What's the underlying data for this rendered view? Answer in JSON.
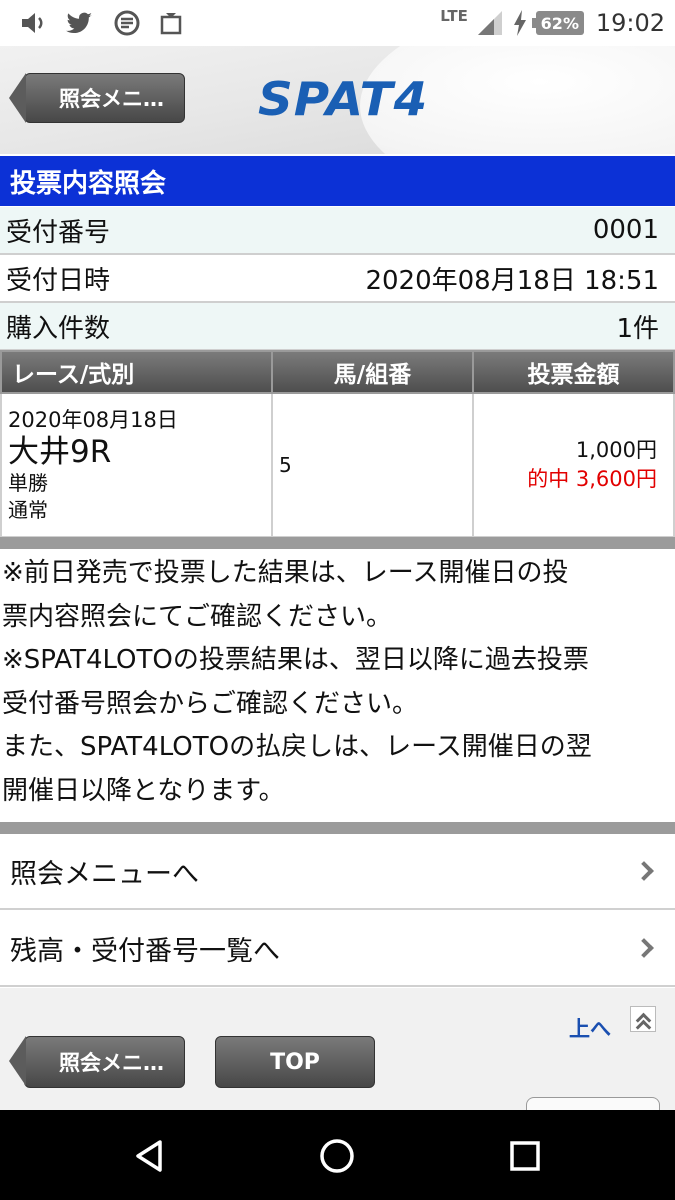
{
  "statusbar": {
    "network": "LTE",
    "battery": "62%",
    "time": "19:02",
    "icons": [
      "volume-icon",
      "twitter-icon",
      "app-icon",
      "storage-icon",
      "signal-icon",
      "charging-icon"
    ]
  },
  "header": {
    "back_label": "照会メニ…",
    "logo": "SPAT4"
  },
  "title": "投票内容照会",
  "info": {
    "receipt_label": "受付番号",
    "receipt_value": "0001",
    "datetime_label": "受付日時",
    "datetime_value": "2020年08月18日 18:51",
    "count_label": "購入件数",
    "count_value": "1件"
  },
  "table": {
    "headers": [
      "レース/式別",
      "馬/組番",
      "投票金額"
    ],
    "rows": [
      {
        "date": "2020年08月18日",
        "venue": "大井9R",
        "bet_type": "単勝",
        "method": "通常",
        "horse": "5",
        "amount": "1,000円",
        "hit": "的中 3,600円"
      }
    ]
  },
  "notes": [
    "※前日発売で投票した結果は、レース開催日の投",
    "票内容照会にてご確認ください。",
    "※SPAT4LOTOの投票結果は、翌日以降に過去投票",
    "受付番号照会からご確認ください。",
    "また、SPAT4LOTOの払戻しは、レース開催日の翌",
    "開催日以降となります。"
  ],
  "links": {
    "menu": "照会メニューへ",
    "balance": "残高・受付番号一覧へ"
  },
  "footer": {
    "up": "上へ",
    "back_label": "照会メニ…",
    "top": "TOP"
  },
  "colors": {
    "title_bar": "#0c31d6",
    "logo": "#1a5fb4",
    "hit": "#e20000",
    "link": "#1a4fb0"
  }
}
